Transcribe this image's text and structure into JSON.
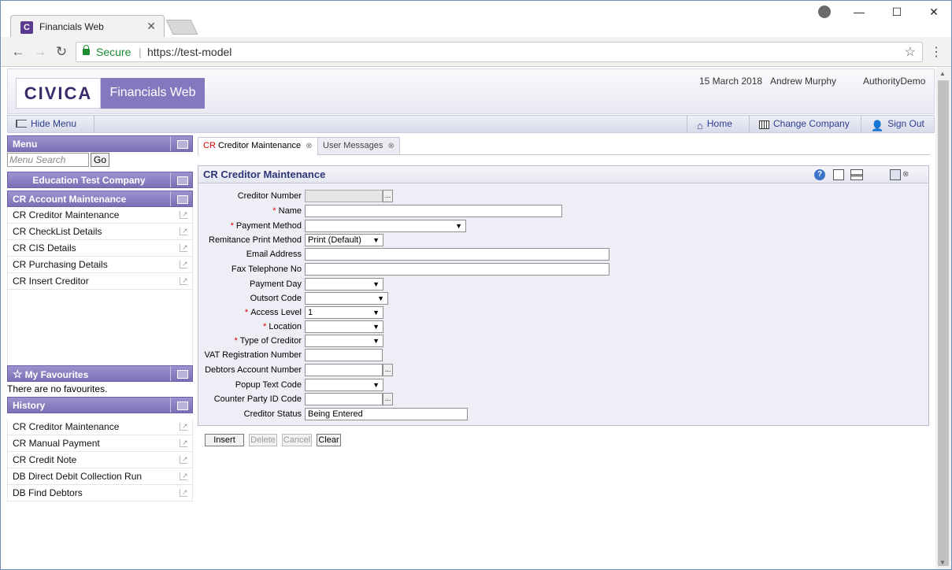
{
  "browser": {
    "tab_title": "Financials Web",
    "favicon_letter": "C",
    "secure_label": "Secure",
    "url": "https://test-model"
  },
  "header": {
    "logo_text": "CIVICA",
    "product_name": "Financials Web",
    "date": "15 March 2018",
    "user": "Andrew Murphy",
    "authority": "AuthorityDemo"
  },
  "navbar": {
    "hide_menu": "Hide Menu",
    "home": "Home",
    "change_company": "Change Company",
    "sign_out": "Sign Out"
  },
  "sidebar": {
    "menu_title": "Menu",
    "search_placeholder": "Menu Search",
    "go_label": "Go",
    "company": "Education Test Company",
    "section": "CR Account Maintenance",
    "items": [
      "CR Creditor Maintenance",
      "CR CheckList Details",
      "CR CIS Details",
      "CR Purchasing Details",
      "CR Insert Creditor"
    ],
    "favourites_title": "My Favourites",
    "favourites_empty": "There are no favourites.",
    "history_title": "History",
    "history": [
      "CR Creditor Maintenance",
      "CR Manual Payment",
      "CR Credit Note",
      "DB Direct Debit Collection Run",
      "DB Find Debtors"
    ]
  },
  "tabs": {
    "active_prefix": "CR",
    "active_label": "Creditor Maintenance",
    "inactive_label": "User Messages"
  },
  "form": {
    "title": "CR Creditor Maintenance",
    "fields": {
      "creditor_number": {
        "label": "Creditor Number",
        "value": ""
      },
      "name": {
        "label": "Name",
        "value": ""
      },
      "payment_method": {
        "label": "Payment Method",
        "value": ""
      },
      "remittance": {
        "label": "Remitance Print Method",
        "value": "Print (Default)"
      },
      "email": {
        "label": "Email Address",
        "value": ""
      },
      "fax": {
        "label": "Fax Telephone No",
        "value": ""
      },
      "payment_day": {
        "label": "Payment Day",
        "value": ""
      },
      "outsort": {
        "label": "Outsort Code",
        "value": ""
      },
      "access_level": {
        "label": "Access Level",
        "value": "1"
      },
      "location": {
        "label": "Location",
        "value": ""
      },
      "type_of_creditor": {
        "label": "Type of Creditor",
        "value": ""
      },
      "vat": {
        "label": "VAT Registration Number",
        "value": ""
      },
      "debtors_account": {
        "label": "Debtors Account Number",
        "value": ""
      },
      "popup_text": {
        "label": "Popup Text Code",
        "value": ""
      },
      "counter_party": {
        "label": "Counter Party ID Code",
        "value": ""
      },
      "creditor_status": {
        "label": "Creditor Status",
        "value": "Being Entered"
      }
    },
    "ellipsis": "...",
    "required_mark": "*"
  },
  "actions": {
    "insert": "Insert",
    "delete": "Delete",
    "cancel": "Cancel",
    "clear": "Clear"
  }
}
